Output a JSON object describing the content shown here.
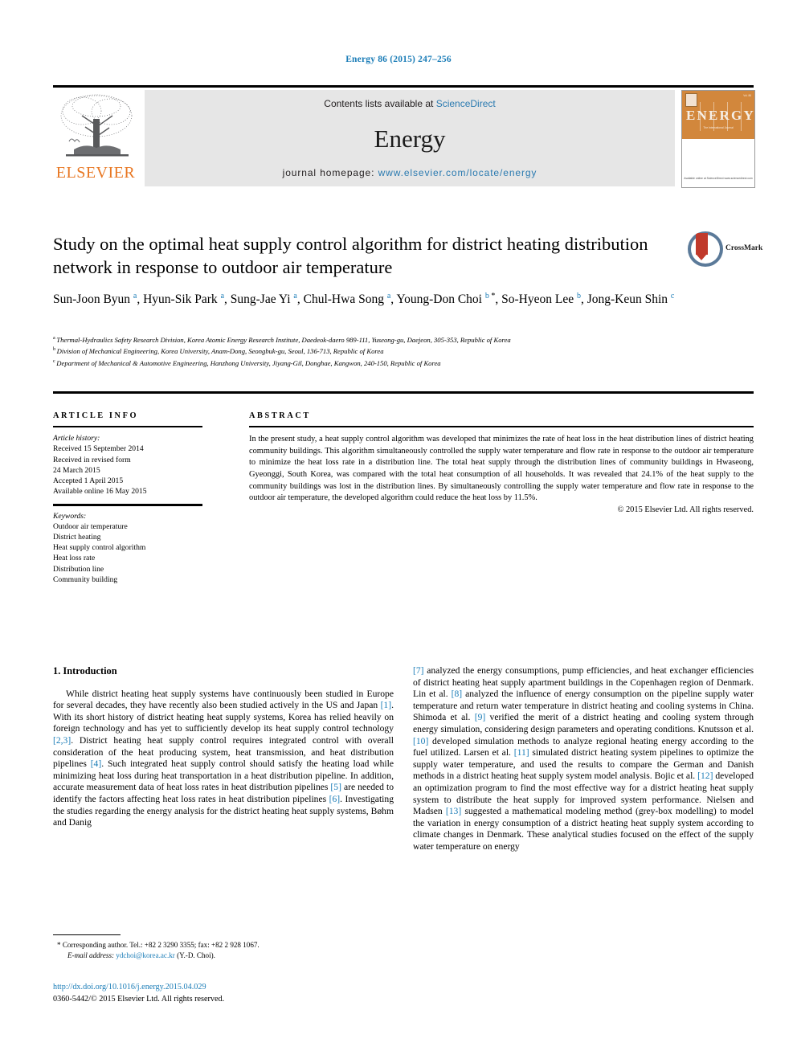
{
  "running_head": "Energy 86 (2015) 247–256",
  "masthead": {
    "contents_prefix": "Contents lists available at ",
    "sciencedirect": "ScienceDirect",
    "journal_name": "Energy",
    "homepage_prefix": "journal homepage: ",
    "homepage_url": "www.elsevier.com/locate/energy",
    "publisher_logo_text": "ELSEVIER",
    "cover": {
      "title": "ENERGY",
      "subtitle": "The International Journal",
      "issue": "Vol. 86",
      "footer": "Available online at\nScienceDirect\nwww.sciencedirect.com"
    }
  },
  "article": {
    "title": "Study on the optimal heat supply control algorithm for district heating distribution network in response to outdoor air temperature",
    "crossmark_label": "CrossMark",
    "authors": [
      {
        "name": "Sun-Joon Byun",
        "marks": "a",
        "star": false
      },
      {
        "name": "Hyun-Sik Park",
        "marks": "a",
        "star": false
      },
      {
        "name": "Sung-Jae Yi",
        "marks": "a",
        "star": false
      },
      {
        "name": "Chul-Hwa Song",
        "marks": "a",
        "star": false
      },
      {
        "name": "Young-Don Choi",
        "marks": "b",
        "star": true
      },
      {
        "name": "So-Hyeon Lee",
        "marks": "b",
        "star": false
      },
      {
        "name": "Jong-Keun Shin",
        "marks": "c",
        "star": false
      }
    ],
    "affiliations": [
      {
        "mark": "a",
        "text": "Thermal-Hydraulics Safety Research Division, Korea Atomic Energy Research Institute, Daedeok-daero 989-111, Yuseong-gu, Daejeon, 305-353, Republic of Korea"
      },
      {
        "mark": "b",
        "text": "Division of Mechanical Engineering, Korea University, Anam-Dong, Seongbuk-gu, Seoul, 136-713, Republic of Korea"
      },
      {
        "mark": "c",
        "text": "Department of Mechanical & Automotive Engineering, Hanzhong University, Jiyang-Gil, Donghae, Kangwon, 240-150, Republic of Korea"
      }
    ]
  },
  "article_info": {
    "heading": "ARTICLE INFO",
    "history_label": "Article history:",
    "history": [
      "Received 15 September 2014",
      "Received in revised form",
      "24 March 2015",
      "Accepted 1 April 2015",
      "Available online 16 May 2015"
    ],
    "keywords_label": "Keywords:",
    "keywords": [
      "Outdoor air temperature",
      "District heating",
      "Heat supply control algorithm",
      "Heat loss rate",
      "Distribution line",
      "Community building"
    ]
  },
  "abstract": {
    "heading": "ABSTRACT",
    "text": "In the present study, a heat supply control algorithm was developed that minimizes the rate of heat loss in the heat distribution lines of district heating community buildings. This algorithm simultaneously controlled the supply water temperature and flow rate in response to the outdoor air temperature to minimize the heat loss rate in a distribution line. The total heat supply through the distribution lines of community buildings in Hwaseong, Gyeonggi, South Korea, was compared with the total heat consumption of all households. It was revealed that 24.1% of the heat supply to the community buildings was lost in the distribution lines. By simultaneously controlling the supply water temperature and flow rate in response to the outdoor air temperature, the developed algorithm could reduce the heat loss by 11.5%.",
    "copyright": "© 2015 Elsevier Ltd. All rights reserved."
  },
  "introduction": {
    "section_number_title": "1. Introduction",
    "left_paragraph_parts": [
      {
        "t": "While district heating heat supply systems have continuously been studied in Europe for several decades, they have recently also been studied actively in the US and Japan "
      },
      {
        "t": "[1]",
        "ref": true
      },
      {
        "t": ". With its short history of district heating heat supply systems, Korea has relied heavily on foreign technology and has yet to sufficiently develop its heat supply control technology "
      },
      {
        "t": "[2,3]",
        "ref": true
      },
      {
        "t": ". District heating heat supply control requires integrated control with overall consideration of the heat producing system, heat transmission, and heat distribution pipelines "
      },
      {
        "t": "[4]",
        "ref": true
      },
      {
        "t": ". Such integrated heat supply control should satisfy the heating load while minimizing heat loss during heat transportation in a heat distribution pipeline. In addition, accurate measurement data of heat loss rates in heat distribution pipelines "
      },
      {
        "t": "[5]",
        "ref": true
      },
      {
        "t": " are needed to identify the factors affecting heat loss rates in heat distribution pipelines "
      },
      {
        "t": "[6]",
        "ref": true
      },
      {
        "t": ". Investigating the studies regarding the energy analysis for the district heating heat supply systems, Bøhm and Danig"
      }
    ],
    "right_paragraph_parts": [
      {
        "t": "[7]",
        "ref": true
      },
      {
        "t": " analyzed the energy consumptions, pump efficiencies, and heat exchanger efficiencies of district heating heat supply apartment buildings in the Copenhagen region of Denmark. Lin et al. "
      },
      {
        "t": "[8]",
        "ref": true
      },
      {
        "t": " analyzed the influence of energy consumption on the pipeline supply water temperature and return water temperature in district heating and cooling systems in China. Shimoda et al. "
      },
      {
        "t": "[9]",
        "ref": true
      },
      {
        "t": " verified the merit of a district heating and cooling system through energy simulation, considering design parameters and operating conditions. Knutsson et al. "
      },
      {
        "t": "[10]",
        "ref": true
      },
      {
        "t": " developed simulation methods to analyze regional heating energy according to the fuel utilized. Larsen et al. "
      },
      {
        "t": "[11]",
        "ref": true
      },
      {
        "t": " simulated district heating system pipelines to optimize the supply water temperature, and used the results to compare the German and Danish methods in a district heating heat supply system model analysis. Bojic et al. "
      },
      {
        "t": "[12]",
        "ref": true
      },
      {
        "t": " developed an optimization program to find the most effective way for a district heating heat supply system to distribute the heat supply for improved system performance. Nielsen and Madsen "
      },
      {
        "t": "[13]",
        "ref": true
      },
      {
        "t": " suggested a mathematical modeling method (grey-box modelling) to model the variation in energy consumption of a district heating heat supply system according to climate changes in Denmark. These analytical studies focused on the effect of the supply water temperature on energy"
      }
    ]
  },
  "footnote": {
    "star": "*",
    "corresponding": "Corresponding author. Tel.: +82 2 3290 3355; fax: +82 2 928 1067.",
    "email_label": "E-mail address:",
    "email": "ydchoi@korea.ac.kr",
    "email_suffix": "(Y.-D. Choi)."
  },
  "footer": {
    "doi": "http://dx.doi.org/10.1016/j.energy.2015.04.029",
    "issn_line": "0360-5442/© 2015 Elsevier Ltd. All rights reserved."
  },
  "colors": {
    "link": "#1a7cb7",
    "elsevier_orange": "#E87722",
    "band_gray": "#e6e6e6",
    "cover_orange": "#d2873c",
    "crossmark_red": "#c0392b"
  }
}
